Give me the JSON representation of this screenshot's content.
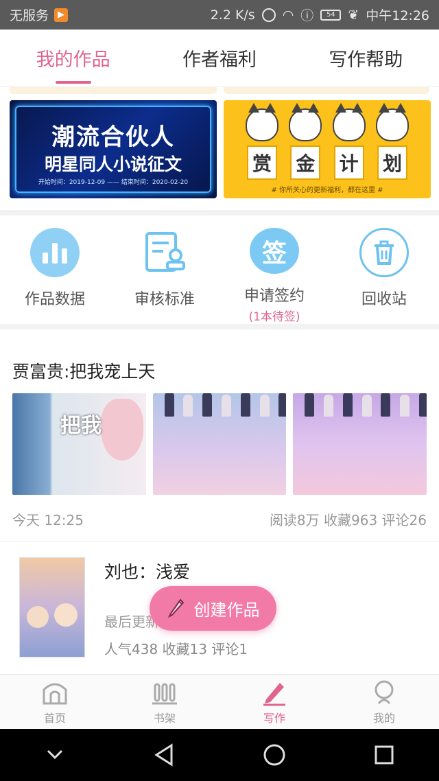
{
  "status_bar": {
    "left_text": "无服务",
    "speed": "2.2 K/s",
    "battery": "54",
    "time": "中午12:26"
  },
  "tabs": [
    {
      "label": "我的作品",
      "active": true
    },
    {
      "label": "作者福利",
      "active": false
    },
    {
      "label": "写作帮助",
      "active": false
    }
  ],
  "banners": {
    "left": {
      "title": "潮流合伙人",
      "subtitle": "明星同人小说征文",
      "dates": "开始时间：2019-12-09 —— 结束时间：2020-02-20"
    },
    "right": {
      "chars": [
        "赏",
        "金",
        "计",
        "划"
      ],
      "note": "# 你所关心的更新福利，都在这里 #"
    }
  },
  "tools": [
    {
      "label": "作品数据",
      "icon": "bar-chart-icon"
    },
    {
      "label": "审核标准",
      "icon": "document-stamp-icon"
    },
    {
      "label": "申请签约",
      "sub": "(1本待签)",
      "icon": "sign-contract-icon"
    },
    {
      "label": "回收站",
      "icon": "trash-icon"
    }
  ],
  "featured": {
    "title": "贾富贵:把我宠上天",
    "cover_text": "把我",
    "time": "今天 12:25",
    "stats": "阅读8万 收藏963 评论26"
  },
  "work": {
    "name": "刘也：浅爱",
    "updated": "最后更新",
    "stats": "人气438 收藏13 评论1"
  },
  "fab": {
    "label": "创建作品"
  },
  "bottom_nav": [
    {
      "label": "首页",
      "icon": "home-icon",
      "active": false
    },
    {
      "label": "书架",
      "icon": "bookshelf-icon",
      "active": false
    },
    {
      "label": "写作",
      "icon": "pen-icon",
      "active": true
    },
    {
      "label": "我的",
      "icon": "profile-icon",
      "active": false
    }
  ],
  "colors": {
    "accent": "#e06490",
    "fab": "#f27aa7",
    "tool_blue": "#6cc2f0"
  }
}
